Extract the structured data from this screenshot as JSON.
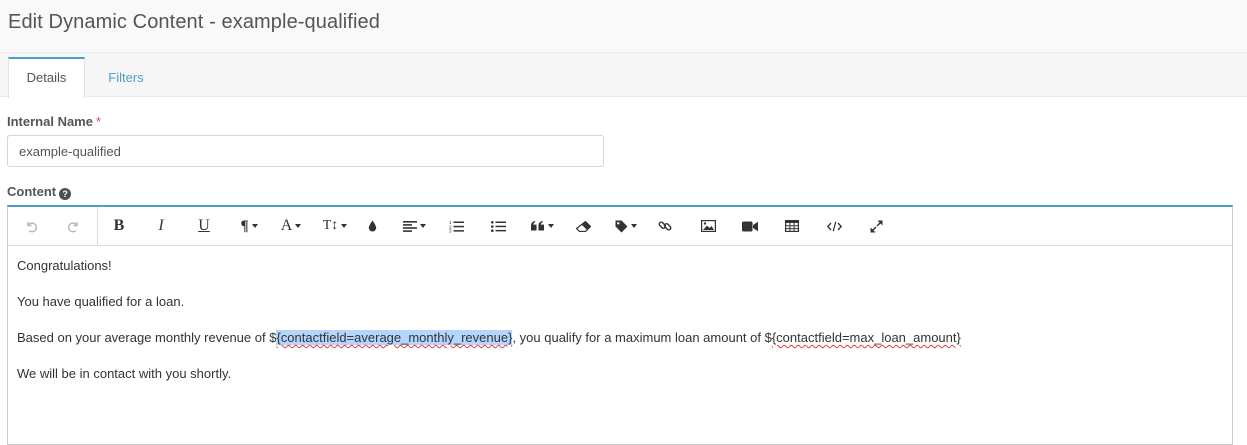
{
  "page": {
    "title": "Edit Dynamic Content - example-qualified"
  },
  "tabs": [
    {
      "label": "Details",
      "active": true
    },
    {
      "label": "Filters",
      "active": false
    }
  ],
  "internal_name": {
    "label": "Internal Name",
    "required_marker": "*",
    "value": "example-qualified"
  },
  "content": {
    "label": "Content",
    "help_icon": "?",
    "toolbar": {
      "buttons": [
        "undo-icon",
        "redo-icon",
        "bold-icon",
        "italic-icon",
        "underline-icon",
        "paragraph-icon",
        "font-color-icon",
        "text-size-icon",
        "background-color-icon",
        "align-icon",
        "ordered-list-icon",
        "unordered-list-icon",
        "quote-icon",
        "eraser-icon",
        "tag-icon",
        "link-icon",
        "image-icon",
        "video-icon",
        "table-icon",
        "code-view-icon",
        "fullscreen-icon"
      ],
      "bold": "B",
      "italic": "I",
      "underline": "U",
      "paragraph": "¶",
      "font": "A",
      "text_size": "T↕"
    },
    "body": {
      "line1": "Congratulations!",
      "line2": "You have qualified for a loan.",
      "line3_before": "Based on your average monthly revenue of $",
      "line3_token1": "{contactfield=average_monthly_revenue}",
      "line3_middle": ", you qualify for a maximum loan amount of $",
      "line3_token2": "{contactfield=max_loan_amount}",
      "line4": "We will be in contact with you shortly."
    }
  },
  "colors": {
    "accent": "#4e9fc6",
    "required": "#e44848",
    "selection": "#b4d5fe",
    "spellcheck": "#e03b3b"
  }
}
